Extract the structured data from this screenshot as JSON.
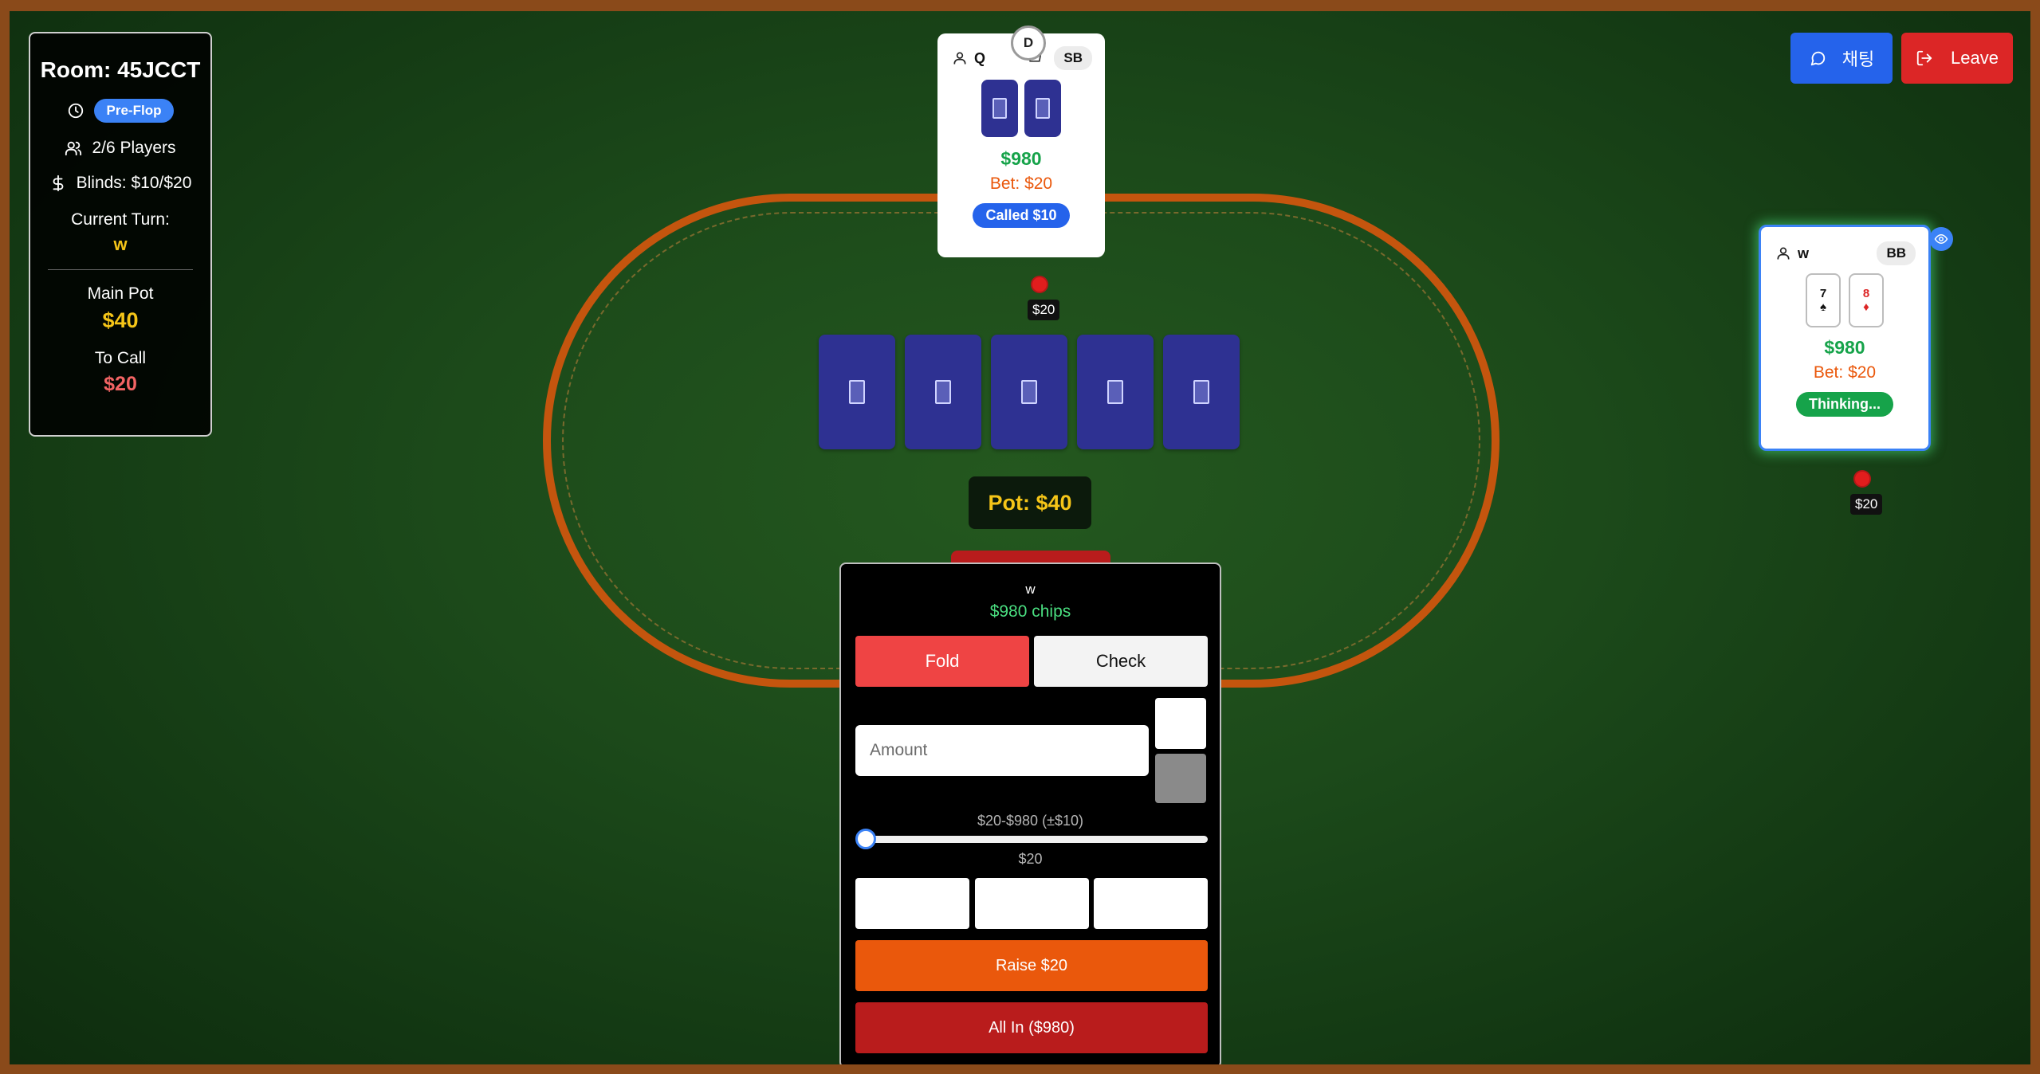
{
  "info": {
    "room": "Room: 45JCCT",
    "phase": "Pre-Flop",
    "players": "2/6 Players",
    "blinds": "Blinds: $10/$20",
    "current_turn_label": "Current Turn:",
    "current_turn": "w",
    "main_pot_label": "Main Pot",
    "main_pot": "$40",
    "to_call_label": "To Call",
    "to_call": "$20"
  },
  "topbar": {
    "chat_label": "채팅",
    "leave_label": "Leave"
  },
  "seats": [
    {
      "name": "Q",
      "position": "SB",
      "dealer_label": "D",
      "chips": "$980",
      "bet": "Bet: $20",
      "status": "Called $10",
      "bet_chip_amount": "$20",
      "cards": [
        "back",
        "back"
      ]
    },
    {
      "name": "w",
      "position": "BB",
      "chips": "$980",
      "bet": "Bet: $20",
      "status": "Thinking...",
      "bet_chip_amount": "$20",
      "cards": [
        {
          "rank": "7",
          "suit": "♠",
          "color": "#111111"
        },
        {
          "rank": "8",
          "suit": "♦",
          "color": "#dc2626"
        }
      ]
    }
  ],
  "community": [
    "back",
    "back",
    "back",
    "back",
    "back"
  ],
  "pot": "Pot: $40",
  "action": {
    "player": "w",
    "chips": "$980 chips",
    "fold_label": "Fold",
    "check_label": "Check",
    "amount_placeholder": "Amount",
    "range_label": "$20-$980 (±$10)",
    "slider_value": "$20",
    "raise_label": "Raise $20",
    "allin_label": "All In ($980)"
  },
  "colors": {
    "felt": "#1c4a1a",
    "rail": "#c4550e",
    "card_back": "#2e3192",
    "chat": "#2563eb",
    "leave": "#dc2626",
    "gold": "#f5c518"
  }
}
